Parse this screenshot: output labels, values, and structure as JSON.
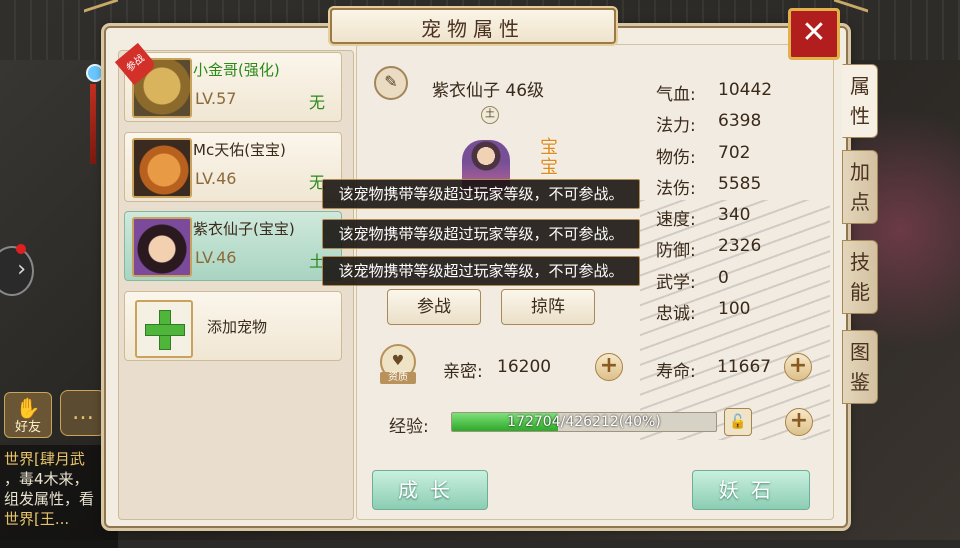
{
  "window": {
    "title": "宠物属性",
    "close_glyph": "✕"
  },
  "pets": [
    {
      "name": "小金哥(强化)",
      "level": "LV.57",
      "element": "无",
      "badge": "参战",
      "selected": false,
      "name_color": "#2a8a1a"
    },
    {
      "name": "Mc天佑(宝宝)",
      "level": "LV.46",
      "element": "无",
      "selected": false,
      "name_color": "#3a2a1a"
    },
    {
      "name": "紫衣仙子(宝宝)",
      "level": "LV.46",
      "element": "土",
      "selected": true,
      "name_color": "#3a2a1a"
    }
  ],
  "add_pet_label": "添加宠物",
  "detail": {
    "name_level": "紫衣仙子 46级",
    "element_badge": "土",
    "status_badge": "宝宝",
    "rename_icon": "pen-icon"
  },
  "stats": [
    {
      "label": "气血:",
      "value": "10442"
    },
    {
      "label": "法力:",
      "value": "6398"
    },
    {
      "label": "物伤:",
      "value": "702"
    },
    {
      "label": "法伤:",
      "value": "5585"
    },
    {
      "label": "速度:",
      "value": "340"
    },
    {
      "label": "防御:",
      "value": "2326"
    },
    {
      "label": "武学:",
      "value": "0"
    },
    {
      "label": "忠诚:",
      "value": "100"
    }
  ],
  "buttons": {
    "fight": "参战",
    "release": "掠阵",
    "grow": "成长",
    "demon_stone": "妖石"
  },
  "intimacy": {
    "label": "亲密:",
    "value": "16200",
    "icon_label": "资质"
  },
  "lifespan": {
    "label": "寿命:",
    "value": "11667"
  },
  "exp": {
    "label": "经验:",
    "text": "172704/426212(40%)",
    "fraction": 0.4
  },
  "tooltips": [
    "该宠物携带等级超过玩家等级，不可参战。",
    "该宠物携带等级超过玩家等级，不可参战。",
    "该宠物携带等级超过玩家等级，不可参战。"
  ],
  "tabs": [
    {
      "label": "属\n性",
      "active": true
    },
    {
      "label": "加\n点",
      "active": false
    },
    {
      "label": "技\n能",
      "active": false
    },
    {
      "label": "图\n鉴",
      "active": false
    }
  ],
  "background": {
    "friend_label": "好友",
    "chat_lines": [
      "世界[肆月武",
      "，毒4木来，",
      "组发属性，看",
      "世界[王..."
    ]
  }
}
